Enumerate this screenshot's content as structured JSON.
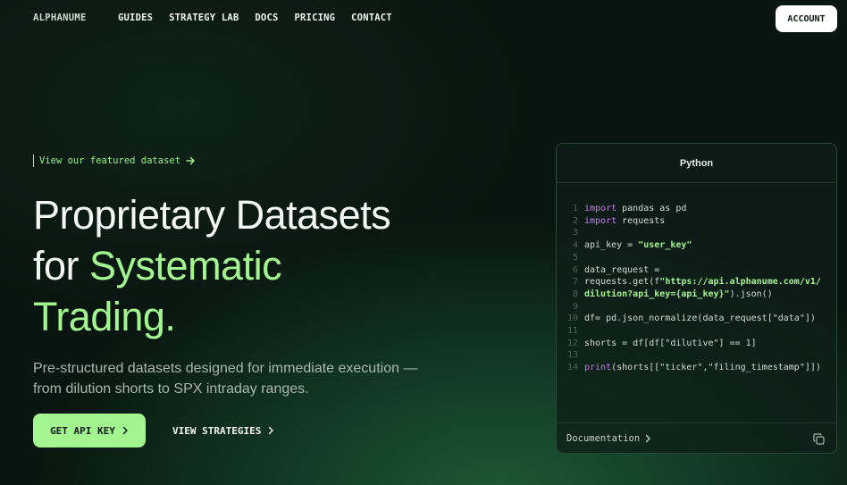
{
  "nav": {
    "logo": "ALPHANUME",
    "links": [
      "GUIDES",
      "STRATEGY LAB",
      "DOCS",
      "PRICING",
      "CONTACT"
    ],
    "account": "ACCOUNT"
  },
  "hero": {
    "featured_link": "View our featured dataset",
    "headline_line1": "Proprietary Datasets",
    "headline_line2_plain": "for ",
    "headline_line2_green": "Systematic",
    "headline_line3_green": "Trading.",
    "subtitle": "Pre-structured datasets designed for immediate execution — from dilution shorts to SPX intraday ranges.",
    "primary_cta": "GET API KEY",
    "secondary_cta": "VIEW STRATEGIES"
  },
  "code_panel": {
    "language_tab": "Python",
    "lines": [
      {
        "n": "1",
        "parts": [
          {
            "t": "import",
            "c": "kw"
          },
          {
            "t": " pandas as pd",
            "c": ""
          }
        ]
      },
      {
        "n": "2",
        "parts": [
          {
            "t": "import",
            "c": "kw"
          },
          {
            "t": " requests",
            "c": ""
          }
        ]
      },
      {
        "n": "3",
        "parts": []
      },
      {
        "n": "4",
        "parts": [
          {
            "t": "api_key = ",
            "c": ""
          },
          {
            "t": "\"user_key\"",
            "c": "str"
          }
        ]
      },
      {
        "n": "5",
        "parts": []
      },
      {
        "n": "6",
        "parts": [
          {
            "t": "data_request =",
            "c": ""
          }
        ]
      },
      {
        "n": "7",
        "parts": [
          {
            "t": "requests.get(f",
            "c": ""
          },
          {
            "t": "\"https://api.alphanume.com/v1/",
            "c": "str"
          }
        ]
      },
      {
        "n": "8",
        "parts": [
          {
            "t": "dilution?api_key={api_key}\"",
            "c": "str"
          },
          {
            "t": ").json()",
            "c": ""
          }
        ]
      },
      {
        "n": "9",
        "parts": []
      },
      {
        "n": "10",
        "parts": [
          {
            "t": "df= pd.json_normalize(data_request[\"data\"])",
            "c": ""
          }
        ]
      },
      {
        "n": "11",
        "parts": []
      },
      {
        "n": "12",
        "parts": [
          {
            "t": "shorts = df[df[\"dilutive\"] == 1]",
            "c": ""
          }
        ]
      },
      {
        "n": "13",
        "parts": []
      },
      {
        "n": "14",
        "parts": [
          {
            "t": "print",
            "c": "kw"
          },
          {
            "t": "(shorts[[\"ticker\",\"filing_timestamp\"]])",
            "c": ""
          }
        ]
      }
    ],
    "footer_link": "Documentation"
  },
  "icons": {
    "featured_arrow": "arrow-right-icon",
    "cta_chevron": "chevron-right-icon",
    "copy": "copy-icon"
  },
  "colors": {
    "accent_green": "#a3f58f",
    "keyword_purple": "#c57ee8",
    "background": "#091510"
  }
}
